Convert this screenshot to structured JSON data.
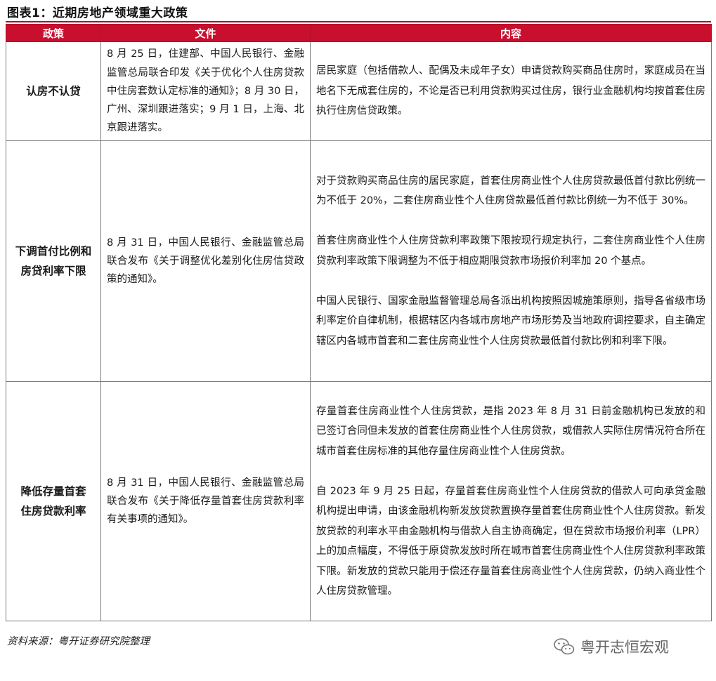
{
  "figure": {
    "title": "图表1：近期房地产领域重大政策"
  },
  "table": {
    "headers": [
      "政策",
      "文件",
      "内容"
    ],
    "rows": [
      {
        "policy": "认房不认贷",
        "document": "8 月 25 日，住建部、中国人民银行、金融监管总局联合印发《关于优化个人住房贷款中住房套数认定标准的通知》；8 月 30 日，广州、深圳跟进落实；9 月 1 日，上海、北京跟进落实。",
        "content": [
          "居民家庭（包括借款人、配偶及未成年子女）申请贷款购买商品住房时，家庭成员在当地名下无成套住房的，不论是否已利用贷款购买过住房，银行业金融机构均按首套住房执行住房信贷政策。"
        ]
      },
      {
        "policy": "下调首付比例和房贷利率下限",
        "document": "8 月 31 日，中国人民银行、金融监管总局联合发布《关于调整优化差别化住房信贷政策的通知》。",
        "content": [
          "对于贷款购买商品住房的居民家庭，首套住房商业性个人住房贷款最低首付款比例统一为不低于 20%，二套住房商业性个人住房贷款最低首付款比例统一为不低于 30%。",
          "首套住房商业性个人住房贷款利率政策下限按现行规定执行，二套住房商业性个人住房贷款利率政策下限调整为不低于相应期限贷款市场报价利率加 20 个基点。",
          "中国人民银行、国家金融监督管理总局各派出机构按照因城施策原则，指导各省级市场利率定价自律机制，根据辖区内各城市房地产市场形势及当地政府调控要求，自主确定辖区内各城市首套和二套住房商业性个人住房贷款最低首付款比例和利率下限。"
        ]
      },
      {
        "policy": "降低存量首套住房贷款利率",
        "document": "8 月 31 日，中国人民银行、金融监管总局联合发布《关于降低存量首套住房贷款利率有关事项的通知》。",
        "content": [
          "存量首套住房商业性个人住房贷款，是指 2023 年 8 月 31 日前金融机构已发放的和已签订合同但未发放的首套住房商业性个人住房贷款，或借款人实际住房情况符合所在城市首套住房标准的其他存量住房商业性个人住房贷款。",
          "自 2023 年 9 月 25 日起，存量首套住房商业性个人住房贷款的借款人可向承贷金融机构提出申请，由该金融机构新发放贷款置换存量首套住房商业性个人住房贷款。新发放贷款的利率水平由金融机构与借款人自主协商确定，但在贷款市场报价利率（LPR）上的加点幅度，不得低于原贷款发放时所在城市首套住房商业性个人住房贷款利率政策下限。新发放的贷款只能用于偿还存量首套住房商业性个人住房贷款，仍纳入商业性个人住房贷款管理。"
        ]
      }
    ]
  },
  "source": "资料来源：粤开证券研究院整理",
  "watermark": {
    "text": "粤开志恒宏观",
    "icon": "wechat-icon"
  }
}
